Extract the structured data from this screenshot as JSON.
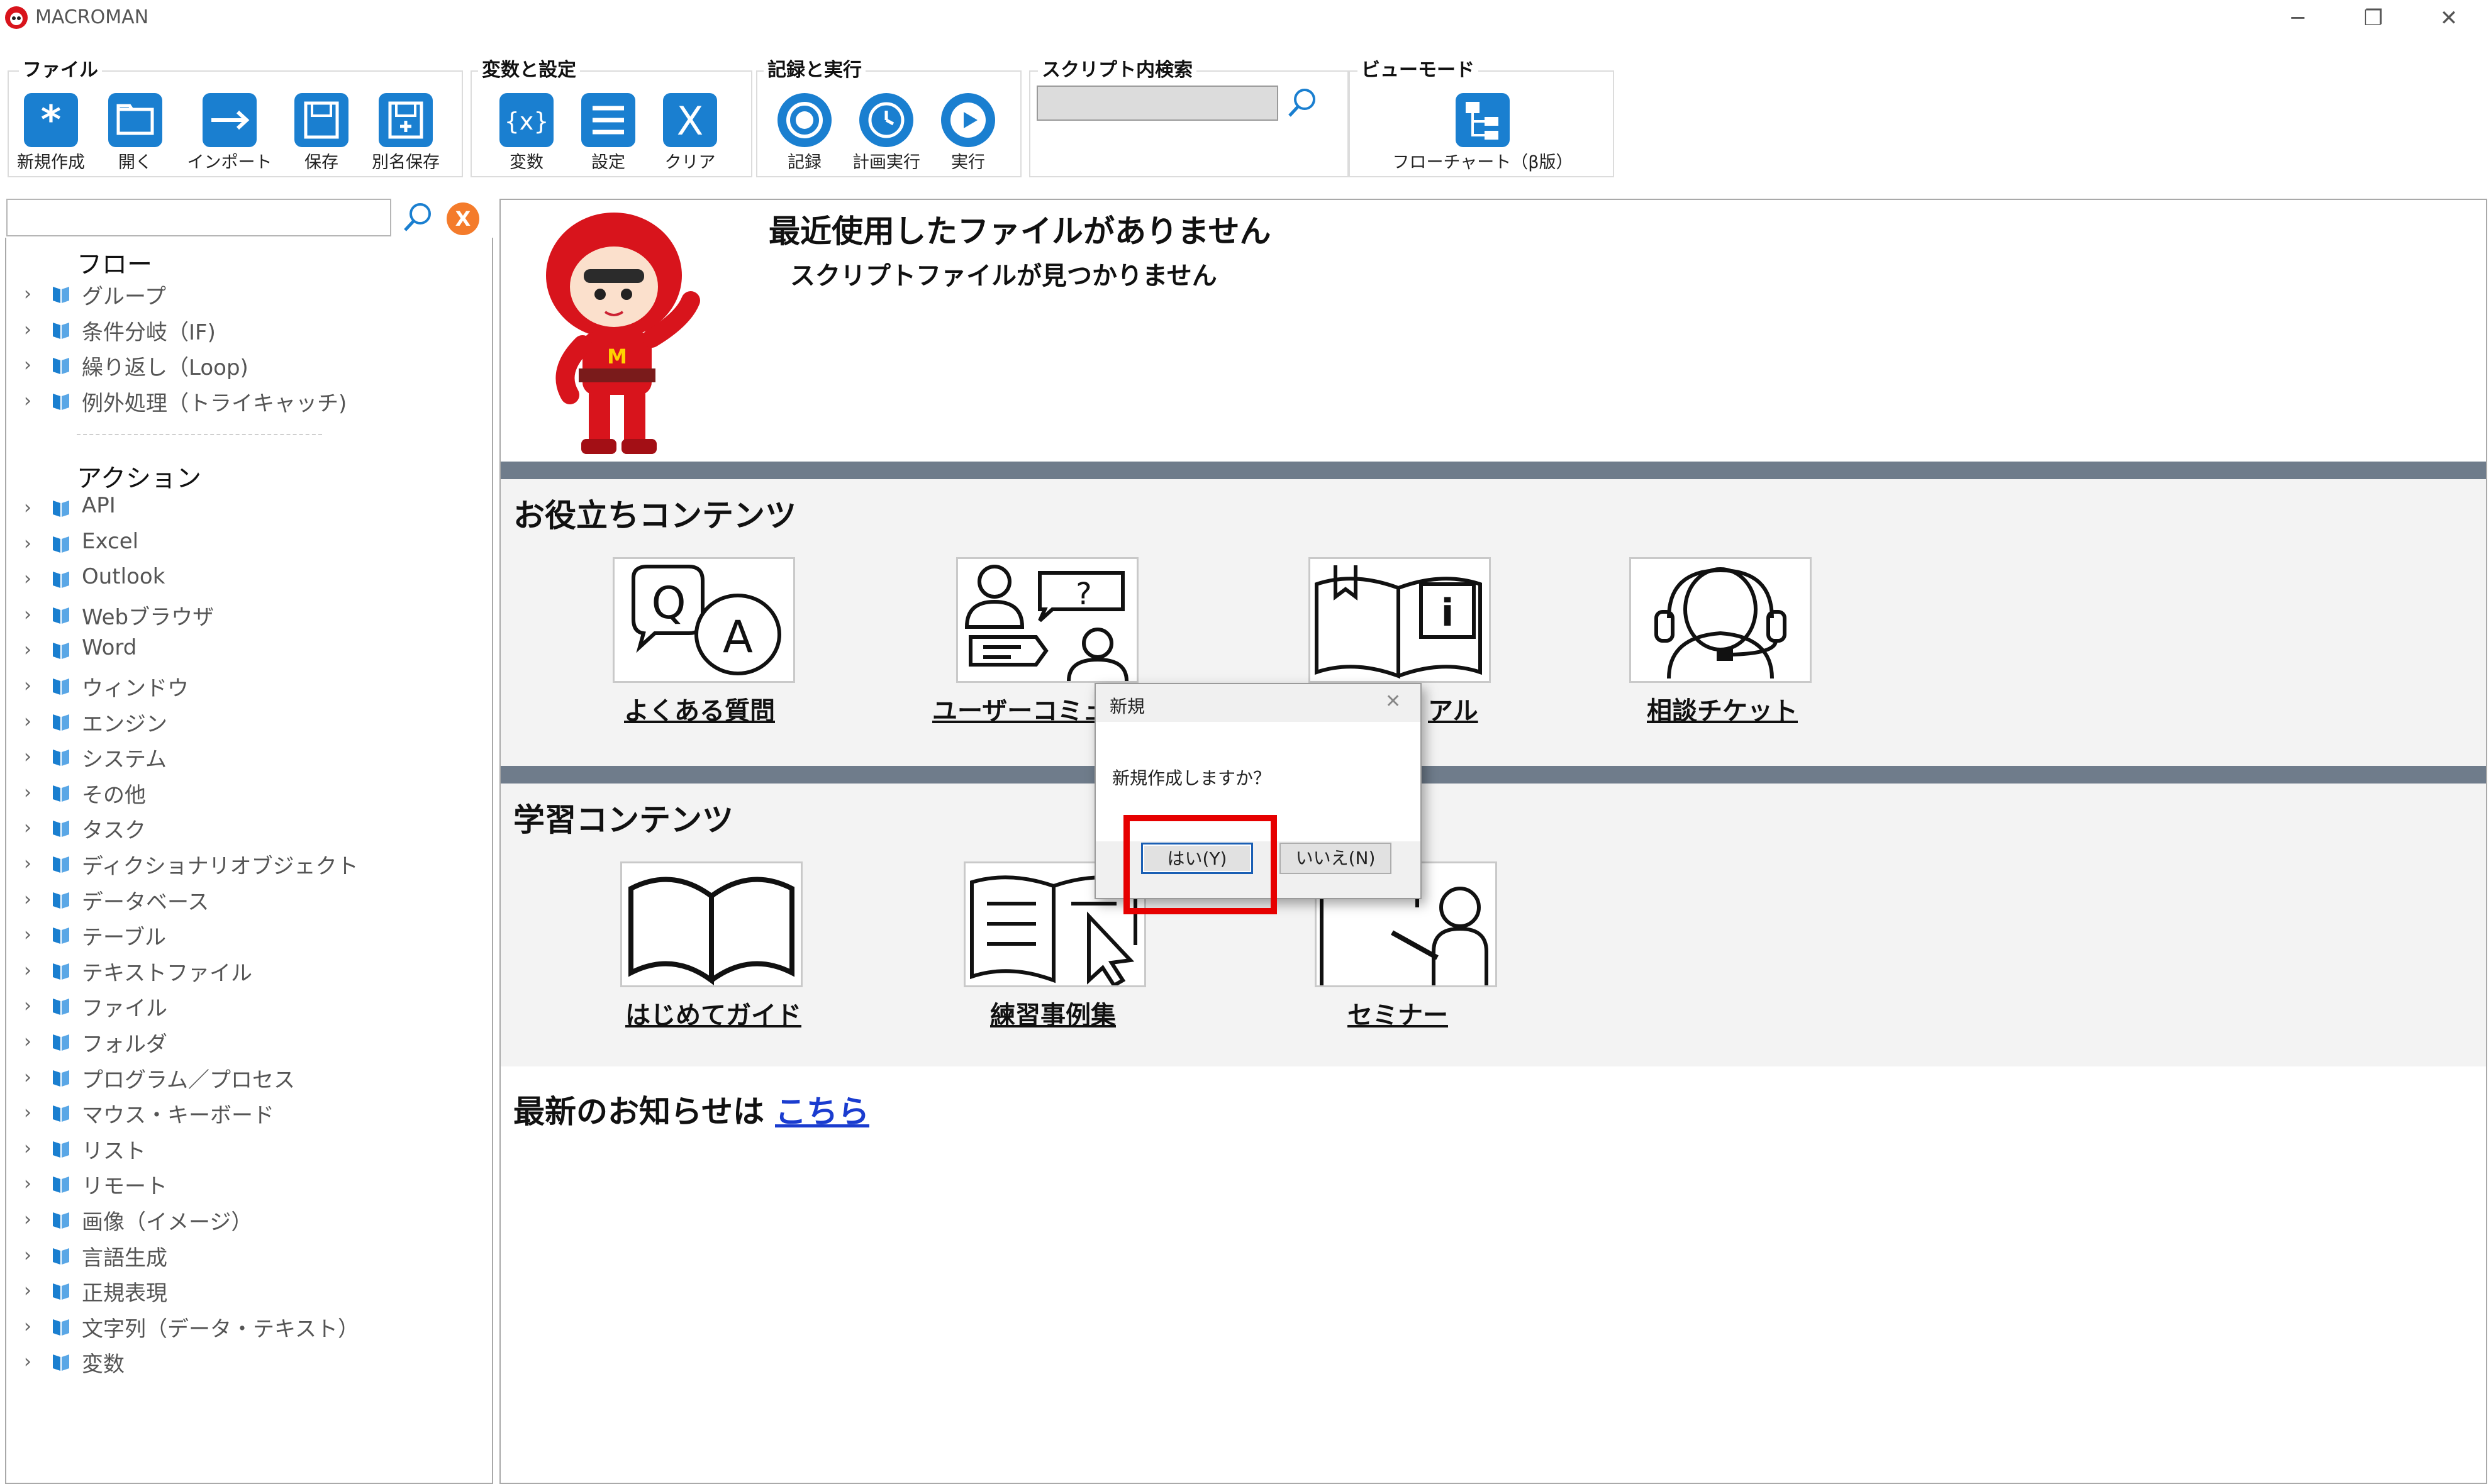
{
  "window": {
    "title": "MACROMAN",
    "minimize": "─",
    "restore": "❐",
    "close": "✕"
  },
  "ribbon": {
    "file": {
      "label": "ファイル",
      "new": "新規作成",
      "open": "開く",
      "import": "インポート",
      "save": "保存",
      "save_as": "別名保存"
    },
    "vars": {
      "label": "変数と設定",
      "variables": "変数",
      "settings": "設定",
      "clear": "クリア",
      "var_glyph": "{x}",
      "clear_glyph": "X"
    },
    "record": {
      "label": "記録と実行",
      "record": "記録",
      "schedule": "計画実行",
      "run": "実行"
    },
    "search": {
      "label": "スクリプト内検索",
      "value": ""
    },
    "view": {
      "label": "ビューモード",
      "flowchart": "フローチャート（β版）"
    }
  },
  "sidebar": {
    "search_value": "",
    "clear_glyph": "X",
    "flow_header": "フロー",
    "flow_items": [
      "グループ",
      "条件分岐（IF)",
      "繰り返し（Loop)",
      "例外処理（トライキャッチ)"
    ],
    "action_header": "アクション",
    "action_items": [
      "API",
      "Excel",
      "Outlook",
      "Webブラウザ",
      "Word",
      "ウィンドウ",
      "エンジン",
      "システム",
      "その他",
      "タスク",
      "ディクショナリオブジェクト",
      "データベース",
      "テーブル",
      "テキストファイル",
      "ファイル",
      "フォルダ",
      "プログラム／プロセス",
      "マウス・キーボード",
      "リスト",
      "リモート",
      "画像（イメージ）",
      "言語生成",
      "正規表現",
      "文字列（データ・テキスト）",
      "変数"
    ],
    "chevron": "›"
  },
  "main": {
    "recent_title": "最近使用したファイルがありません",
    "recent_sub": "スクリプトファイルが見つかりません",
    "useful_header": "お役立ちコンテンツ",
    "useful_tiles": [
      "よくある質問",
      "ユーザーコミュ",
      "アル",
      "相談チケット"
    ],
    "learn_header": "学習コンテンツ",
    "learn_tiles": [
      "はじめてガイド",
      "練習事例集",
      "セミナー"
    ],
    "news_text": "最新のお知らせは",
    "news_link": "こちら"
  },
  "dialog": {
    "title": "新規",
    "message": "新規作成しますか？",
    "yes": "はい(Y)",
    "no": "いいえ(N)",
    "close": "✕"
  },
  "colors": {
    "accent": "#1a7fd0",
    "band": "#6f7c8b",
    "highlight": "#e60000",
    "link": "#1a3ccf"
  }
}
